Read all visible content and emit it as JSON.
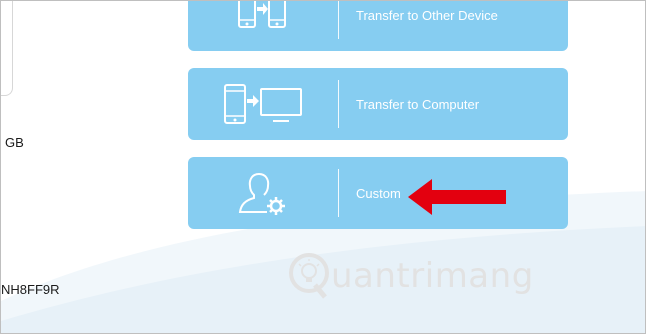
{
  "side": {
    "capacity_text": "GB",
    "serial_text": "NH8FF9R"
  },
  "options": [
    {
      "label": "Transfer to Other Device",
      "icon": "phone-to-phone-icon"
    },
    {
      "label": "Transfer to Computer",
      "icon": "phone-to-computer-icon"
    },
    {
      "label": "Custom",
      "icon": "user-settings-icon"
    }
  ],
  "watermark": {
    "text": "uantrimang",
    "icon": "lightbulb-q-logo"
  },
  "colors": {
    "card": "#86cdf1",
    "arrow": "#e3000f",
    "text_on_card": "#ffffff"
  }
}
